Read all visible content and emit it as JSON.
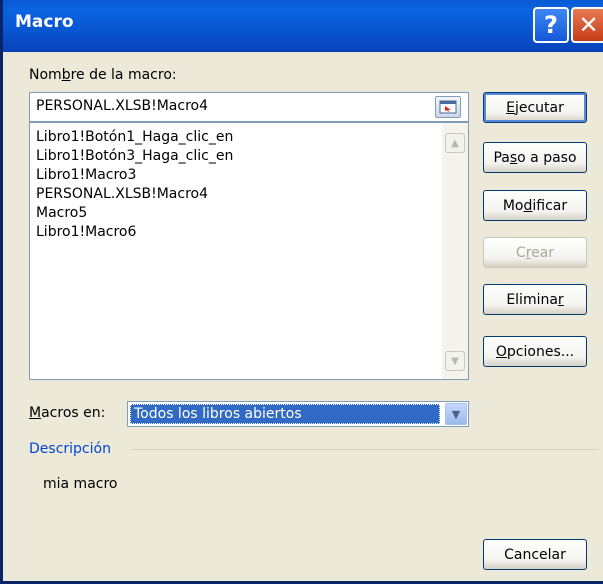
{
  "window": {
    "title": "Macro"
  },
  "macro_name": {
    "label": "Nombre de la macro:",
    "value": "PERSONAL.XLSB!Macro4"
  },
  "macro_list": [
    "Libro1!Botón1_Haga_clic_en",
    "Libro1!Botón3_Haga_clic_en",
    "Libro1!Macro3",
    "PERSONAL.XLSB!Macro4",
    "Macro5",
    "Libro1!Macro6"
  ],
  "buttons": {
    "run": "Ejecutar",
    "step": "Paso a paso",
    "edit": "Modificar",
    "create": "Crear",
    "delete": "Eliminar",
    "options": "Opciones...",
    "cancel": "Cancelar"
  },
  "macros_in": {
    "label": "Macros en:",
    "selected": "Todos los libros abiertos"
  },
  "description": {
    "label": "Descripción",
    "text": "mia macro"
  },
  "colors": {
    "title_bar": "#0a5ad6",
    "selection": "#316ac5",
    "section_label": "#0046d5"
  }
}
